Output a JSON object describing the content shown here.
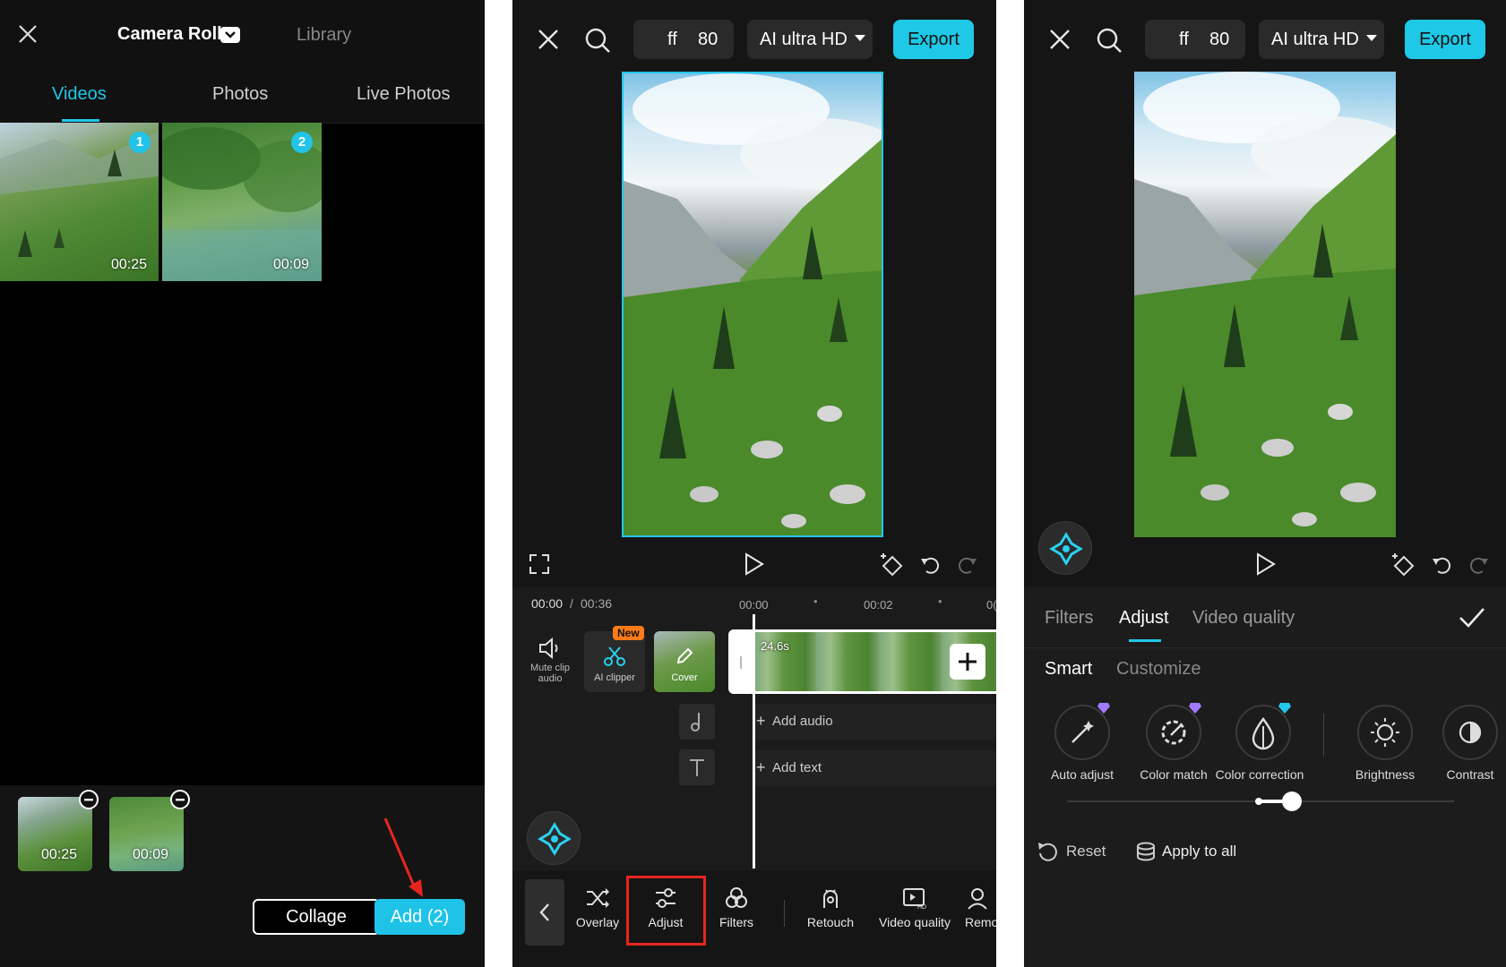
{
  "picker": {
    "title": "Camera Roll",
    "library_tab": "Library",
    "tabs": [
      "Videos",
      "Photos",
      "Live Photos"
    ],
    "clips": [
      {
        "index": "1",
        "duration": "00:25"
      },
      {
        "index": "2",
        "duration": "00:09"
      }
    ],
    "selected": [
      {
        "duration": "00:25"
      },
      {
        "duration": "00:09"
      }
    ],
    "collage_label": "Collage",
    "add_label": "Add (2)"
  },
  "editor": {
    "fps_label": "ff",
    "fps_value": "80",
    "quality_label": "AI ultra HD",
    "export_label": "Export",
    "time_current": "00:00",
    "time_sep": "/",
    "time_total": "00:36",
    "ruler": [
      "00:00",
      "00:02",
      "0("
    ],
    "mute_label": "Mute clip audio",
    "new_badge": "New",
    "ai_clipper_label": "AI clipper",
    "cover_label": "Cover",
    "clip_duration": "24.6s",
    "add_audio": "Add audio",
    "add_text": "Add text",
    "toolbar": [
      "Overlay",
      "Adjust",
      "Filters",
      "Retouch",
      "Video quality",
      "Remo"
    ]
  },
  "adjust": {
    "fps_label": "ff",
    "fps_value": "80",
    "quality_label": "AI ultra HD",
    "export_label": "Export",
    "tabs": [
      "Filters",
      "Adjust",
      "Video quality"
    ],
    "subtabs": [
      "Smart",
      "Customize"
    ],
    "tools": [
      "Auto adjust",
      "Color match",
      "Color correction",
      "Brightness",
      "Contrast"
    ],
    "slider_fraction": 0.58,
    "reset_label": "Reset",
    "apply_all_label": "Apply to all"
  },
  "colors": {
    "accent": "#1ec8e6",
    "highlight_red": "#e5261f",
    "badge_orange": "#ff7a1a",
    "premium_purple": "#a07bff"
  }
}
